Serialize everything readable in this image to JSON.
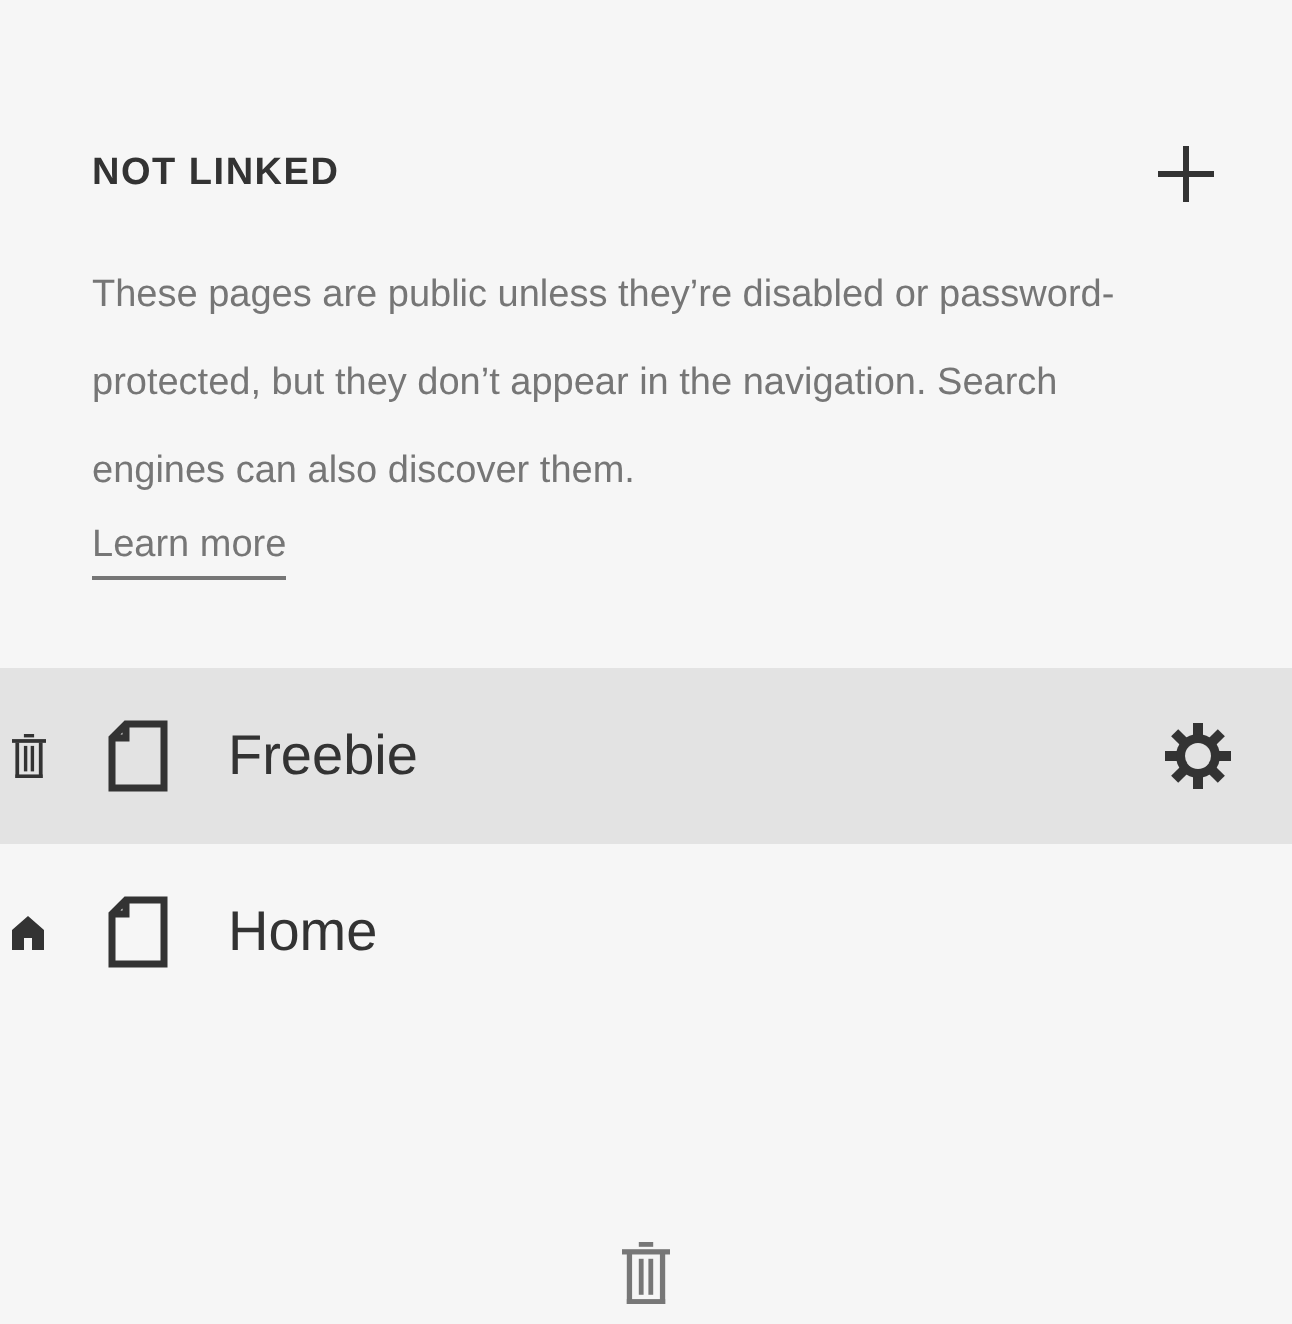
{
  "section": {
    "title": "NOT LINKED",
    "description": "These pages are public unless they’re disabled or password-protected, but they don’t appear in the navigation. Search engines can also discover them.",
    "link": "Learn more"
  },
  "pages": [
    {
      "title": "Freebie",
      "selected": true,
      "is_home": false
    },
    {
      "title": "Home",
      "selected": false,
      "is_home": true
    }
  ]
}
